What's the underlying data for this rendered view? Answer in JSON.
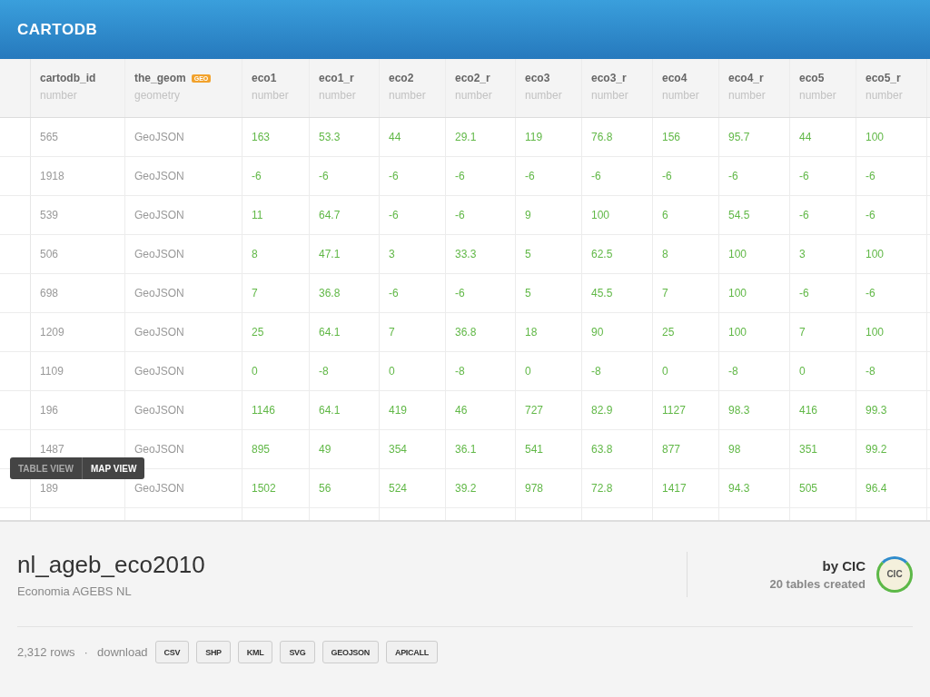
{
  "header": {
    "logo": "CARTODB"
  },
  "table": {
    "columns": [
      {
        "name": "cartodb_id",
        "type": "number"
      },
      {
        "name": "the_geom",
        "type": "geometry",
        "badge": "GEO"
      },
      {
        "name": "eco1",
        "type": "number"
      },
      {
        "name": "eco1_r",
        "type": "number"
      },
      {
        "name": "eco2",
        "type": "number"
      },
      {
        "name": "eco2_r",
        "type": "number"
      },
      {
        "name": "eco3",
        "type": "number"
      },
      {
        "name": "eco3_r",
        "type": "number"
      },
      {
        "name": "eco4",
        "type": "number"
      },
      {
        "name": "eco4_r",
        "type": "number"
      },
      {
        "name": "eco5",
        "type": "number"
      },
      {
        "name": "eco5_r",
        "type": "number"
      }
    ],
    "rows": [
      [
        "565",
        "GeoJSON",
        "163",
        "53.3",
        "44",
        "29.1",
        "119",
        "76.8",
        "156",
        "95.7",
        "44",
        "100"
      ],
      [
        "1918",
        "GeoJSON",
        "-6",
        "-6",
        "-6",
        "-6",
        "-6",
        "-6",
        "-6",
        "-6",
        "-6",
        "-6"
      ],
      [
        "539",
        "GeoJSON",
        "11",
        "64.7",
        "-6",
        "-6",
        "9",
        "100",
        "6",
        "54.5",
        "-6",
        "-6"
      ],
      [
        "506",
        "GeoJSON",
        "8",
        "47.1",
        "3",
        "33.3",
        "5",
        "62.5",
        "8",
        "100",
        "3",
        "100"
      ],
      [
        "698",
        "GeoJSON",
        "7",
        "36.8",
        "-6",
        "-6",
        "5",
        "45.5",
        "7",
        "100",
        "-6",
        "-6"
      ],
      [
        "1209",
        "GeoJSON",
        "25",
        "64.1",
        "7",
        "36.8",
        "18",
        "90",
        "25",
        "100",
        "7",
        "100"
      ],
      [
        "1109",
        "GeoJSON",
        "0",
        "-8",
        "0",
        "-8",
        "0",
        "-8",
        "0",
        "-8",
        "0",
        "-8"
      ],
      [
        "196",
        "GeoJSON",
        "1146",
        "64.1",
        "419",
        "46",
        "727",
        "82.9",
        "1127",
        "98.3",
        "416",
        "99.3"
      ],
      [
        "1487",
        "GeoJSON",
        "895",
        "49",
        "354",
        "36.1",
        "541",
        "63.8",
        "877",
        "98",
        "351",
        "99.2"
      ],
      [
        "189",
        "GeoJSON",
        "1502",
        "56",
        "524",
        "39.2",
        "978",
        "72.8",
        "1417",
        "94.3",
        "505",
        "96.4"
      ]
    ]
  },
  "view_toggle": [
    {
      "label": "TABLE VIEW",
      "selected": false
    },
    {
      "label": "MAP VIEW",
      "selected": true
    }
  ],
  "footer": {
    "title": "nl_ageb_eco2010",
    "description": "Economia AGEBS NL",
    "author": "by CIC",
    "author_tables": "20 tables created",
    "avatar_text": "CIC",
    "row_count": "2,312 rows",
    "separator": "·",
    "download_label": "download",
    "formats": [
      "CSV",
      "SHP",
      "KML",
      "SVG",
      "GEOJSON",
      "APICALL"
    ]
  }
}
